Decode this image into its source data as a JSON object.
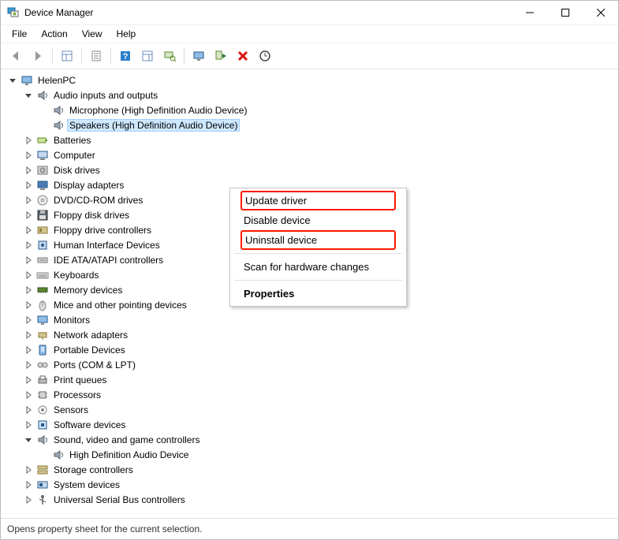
{
  "window": {
    "title": "Device Manager"
  },
  "menubar": [
    {
      "label": "File"
    },
    {
      "label": "Action"
    },
    {
      "label": "View"
    },
    {
      "label": "Help"
    }
  ],
  "toolbar": {
    "back": "Back",
    "forward": "Forward",
    "panel": "Show/Hide Console Tree",
    "propsheet": "Properties",
    "help": "Help",
    "actions": "Action",
    "scan": "Scan for hardware changes",
    "monitor": "Show hidden devices",
    "enable": "Enable device",
    "remove": "Uninstall",
    "update": "Update Device"
  },
  "tree": {
    "root": {
      "label": "HelenPC",
      "expanded": true,
      "icon": "pc"
    },
    "audio": {
      "label": "Audio inputs and outputs",
      "expanded": true,
      "icon": "speaker",
      "children": [
        {
          "label": "Microphone (High Definition Audio Device)",
          "icon": "speaker",
          "selected": false
        },
        {
          "label": "Speakers (High Definition Audio Device)",
          "icon": "speaker",
          "selected": true
        }
      ]
    },
    "items": [
      {
        "label": "Batteries",
        "icon": "battery"
      },
      {
        "label": "Computer",
        "icon": "computer"
      },
      {
        "label": "Disk drives",
        "icon": "disk"
      },
      {
        "label": "Display adapters",
        "icon": "display"
      },
      {
        "label": "DVD/CD-ROM drives",
        "icon": "cd"
      },
      {
        "label": "Floppy disk drives",
        "icon": "floppy"
      },
      {
        "label": "Floppy drive controllers",
        "icon": "floppyctl"
      },
      {
        "label": "Human Interface Devices",
        "icon": "hid"
      },
      {
        "label": "IDE ATA/ATAPI controllers",
        "icon": "ide"
      },
      {
        "label": "Keyboards",
        "icon": "keyboard"
      },
      {
        "label": "Memory devices",
        "icon": "memory"
      },
      {
        "label": "Mice and other pointing devices",
        "icon": "mouse"
      },
      {
        "label": "Monitors",
        "icon": "monitor"
      },
      {
        "label": "Network adapters",
        "icon": "network"
      },
      {
        "label": "Portable Devices",
        "icon": "portable"
      },
      {
        "label": "Ports (COM & LPT)",
        "icon": "port"
      },
      {
        "label": "Print queues",
        "icon": "printer"
      },
      {
        "label": "Processors",
        "icon": "cpu"
      },
      {
        "label": "Sensors",
        "icon": "sensor"
      },
      {
        "label": "Software devices",
        "icon": "software"
      }
    ],
    "svgc": {
      "label": "Sound, video and game controllers",
      "expanded": true,
      "icon": "speaker",
      "children": [
        {
          "label": "High Definition Audio Device",
          "icon": "speaker"
        }
      ]
    },
    "tail": [
      {
        "label": "Storage controllers",
        "icon": "storage"
      },
      {
        "label": "System devices",
        "icon": "system"
      },
      {
        "label": "Universal Serial Bus controllers",
        "icon": "usb"
      }
    ]
  },
  "context_menu": {
    "update": "Update driver",
    "disable": "Disable device",
    "uninstall": "Uninstall device",
    "scan": "Scan for hardware changes",
    "properties": "Properties"
  },
  "status": "Opens property sheet for the current selection."
}
